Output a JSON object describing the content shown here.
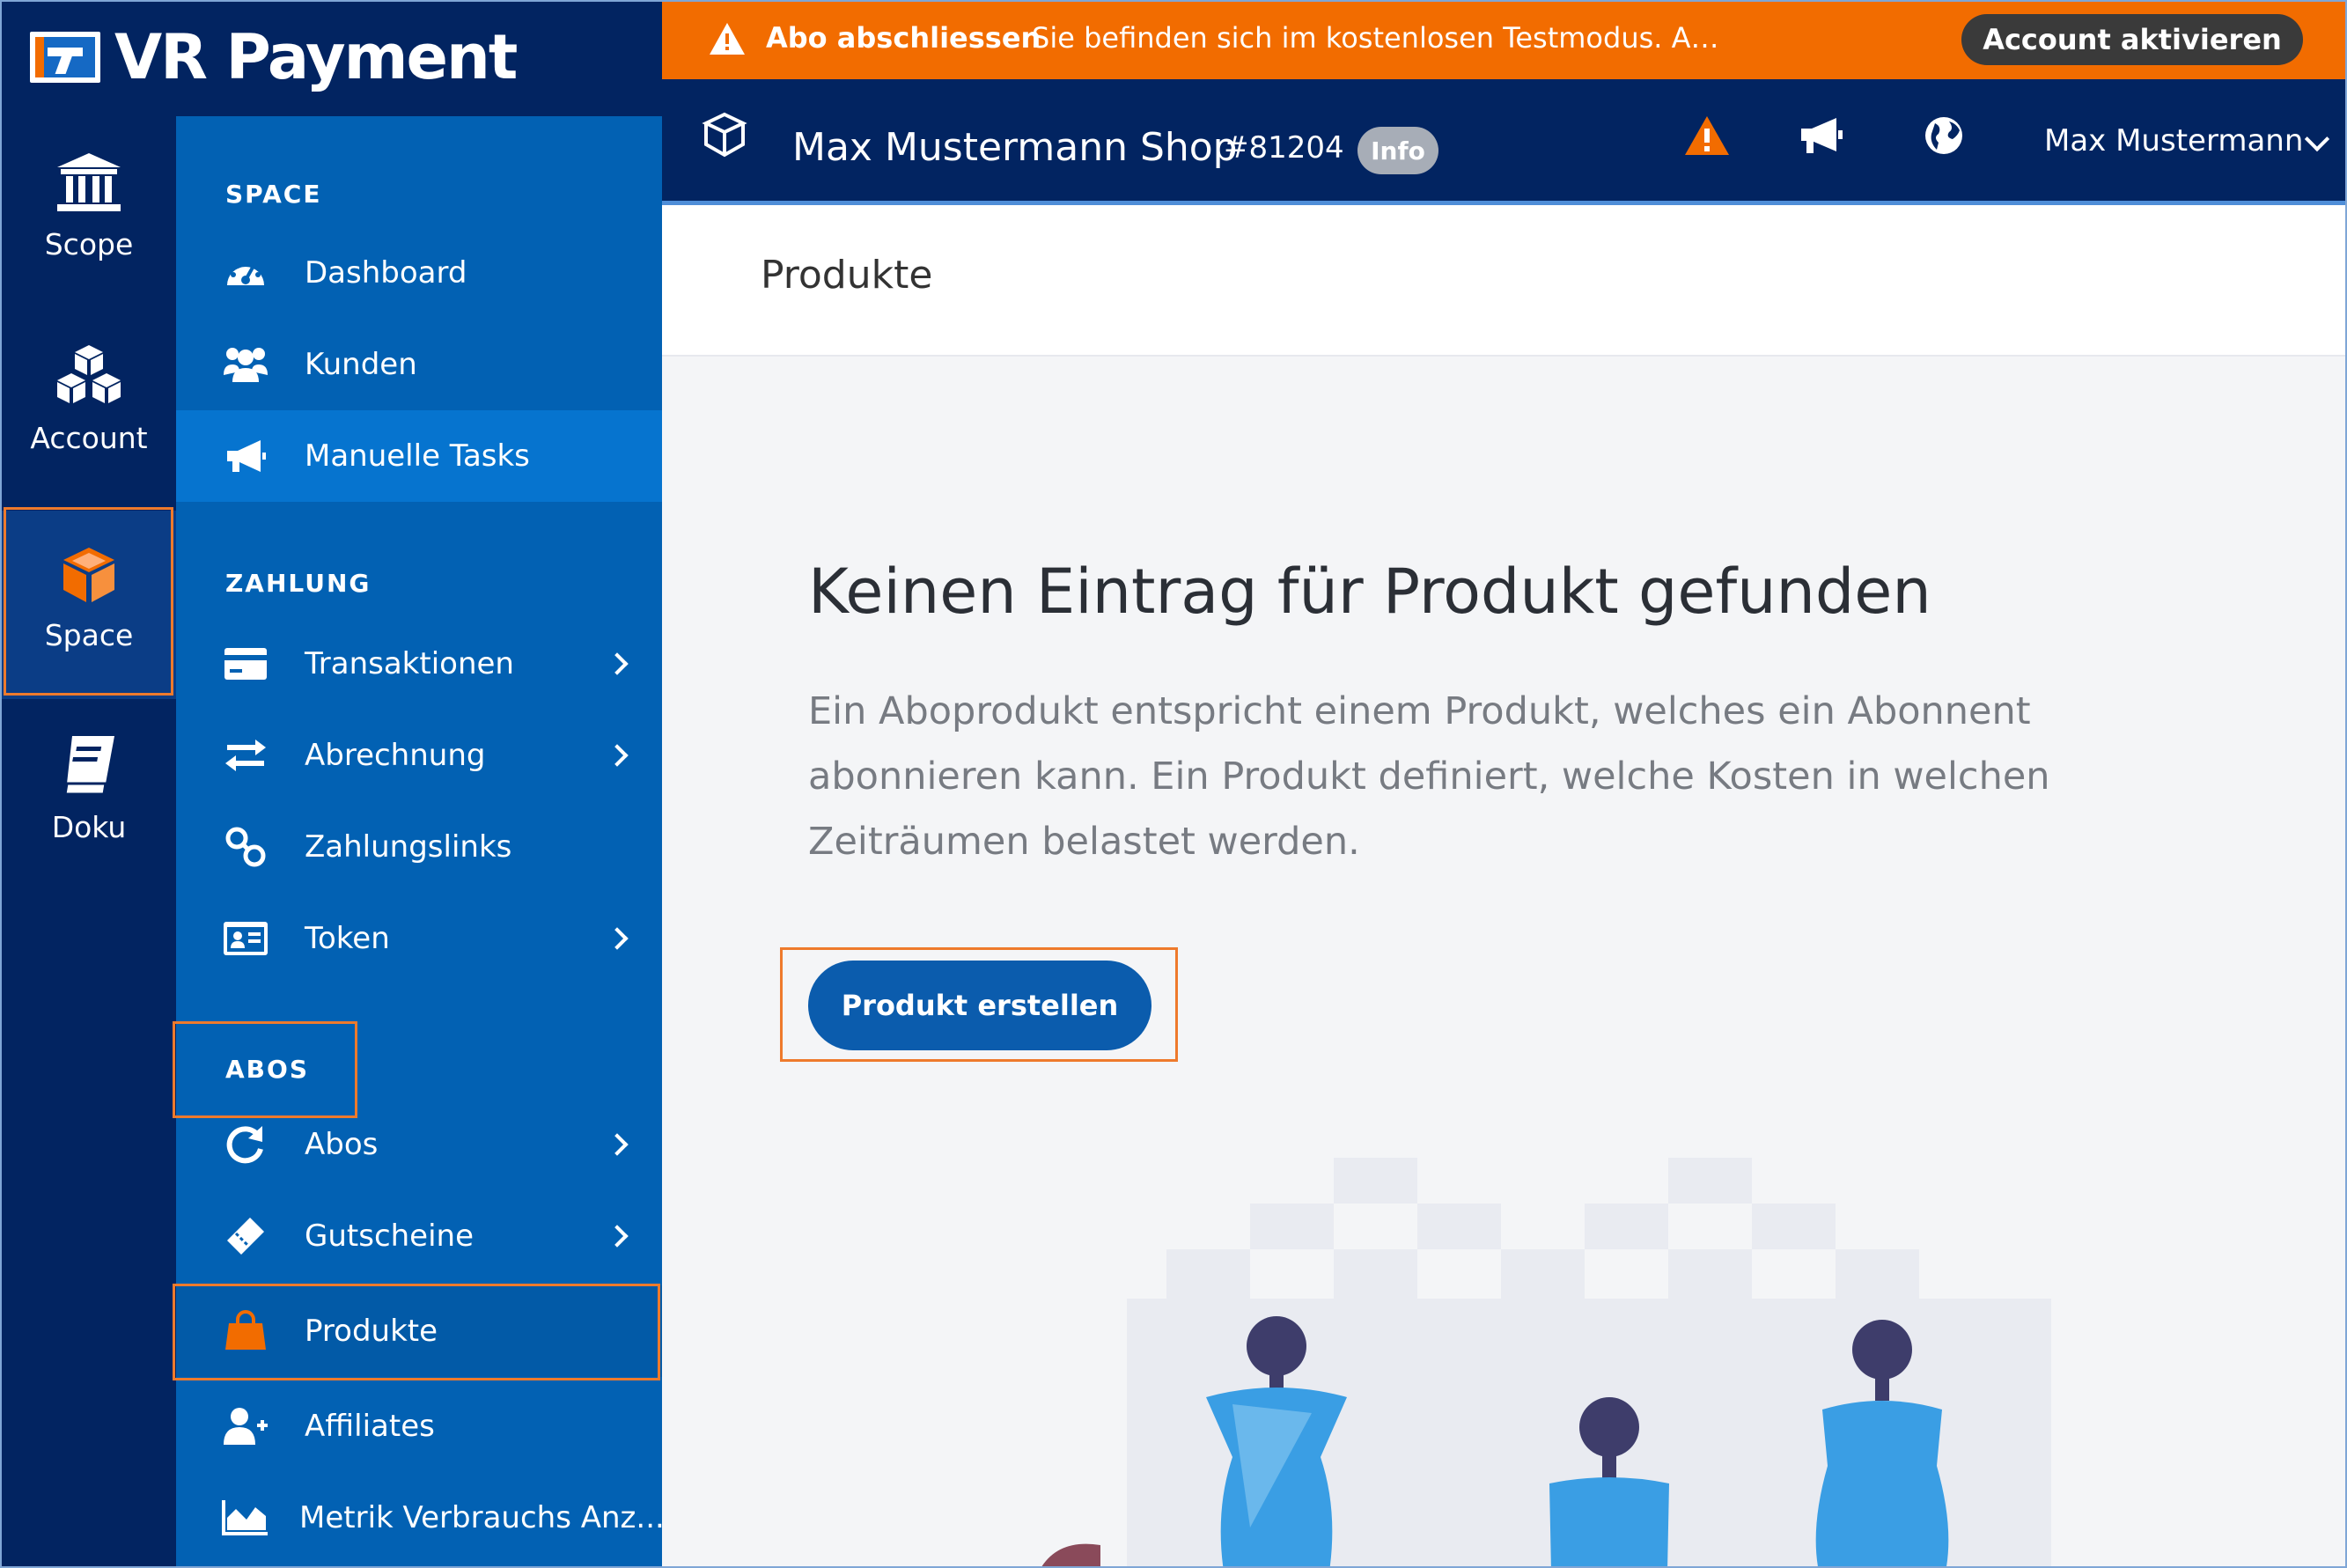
{
  "brand": {
    "name": "VR Payment"
  },
  "rail": {
    "items": [
      {
        "label": "Scope",
        "icon": "bank-icon"
      },
      {
        "label": "Account",
        "icon": "cubes-icon"
      },
      {
        "label": "Space",
        "icon": "cube-icon",
        "selected": true
      },
      {
        "label": "Doku",
        "icon": "book-icon"
      }
    ]
  },
  "sidebar": {
    "sections": [
      {
        "title": "SPACE",
        "items": [
          {
            "label": "Dashboard",
            "icon": "dashboard-icon"
          },
          {
            "label": "Kunden",
            "icon": "users-icon"
          },
          {
            "label": "Manuelle Tasks",
            "icon": "megaphone-icon",
            "active": true
          }
        ]
      },
      {
        "title": "ZAHLUNG",
        "items": [
          {
            "label": "Transaktionen",
            "icon": "credit-card-icon",
            "has_submenu": true
          },
          {
            "label": "Abrechnung",
            "icon": "exchange-icon",
            "has_submenu": true
          },
          {
            "label": "Zahlungslinks",
            "icon": "link-icon"
          },
          {
            "label": "Token",
            "icon": "id-card-icon",
            "has_submenu": true
          }
        ]
      },
      {
        "title": "ABOS",
        "items": [
          {
            "label": "Abos",
            "icon": "refresh-icon",
            "has_submenu": true
          },
          {
            "label": "Gutscheine",
            "icon": "ticket-icon",
            "has_submenu": true
          },
          {
            "label": "Produkte",
            "icon": "shopping-bag-icon",
            "selected": true
          },
          {
            "label": "Affiliates",
            "icon": "user-plus-icon"
          },
          {
            "label": "Metrik Verbrauchs Anz...",
            "icon": "area-chart-icon"
          }
        ]
      }
    ]
  },
  "warning_bar": {
    "title": "Abo abschliessen",
    "message": "Sie befinden sich im kostenlosen Testmodus. Aktivieren Sie Ihr K...",
    "button_label": "Account aktivieren",
    "color": "#f26c00"
  },
  "header": {
    "shop_name": "Max Mustermann Shop",
    "shop_id": "#81204",
    "badge": "Info",
    "user_name": "Max Mustermann"
  },
  "page": {
    "title": "Produkte",
    "empty_heading": "Keinen Eintrag für Produkt gefunden",
    "empty_text": "Ein Aboprodukt entspricht einem Produkt, welches ein Abonnent abonnieren kann. Ein Produkt definiert, welche Kosten in welchen Zeiträumen belastet werden.",
    "create_button": "Produkt erstellen"
  },
  "colors": {
    "rail_bg": "#022461",
    "sidebar_bg": "#0261b3",
    "accent": "#f26c00",
    "button": "#0b5cad",
    "highlight": "#ee7a2c"
  }
}
